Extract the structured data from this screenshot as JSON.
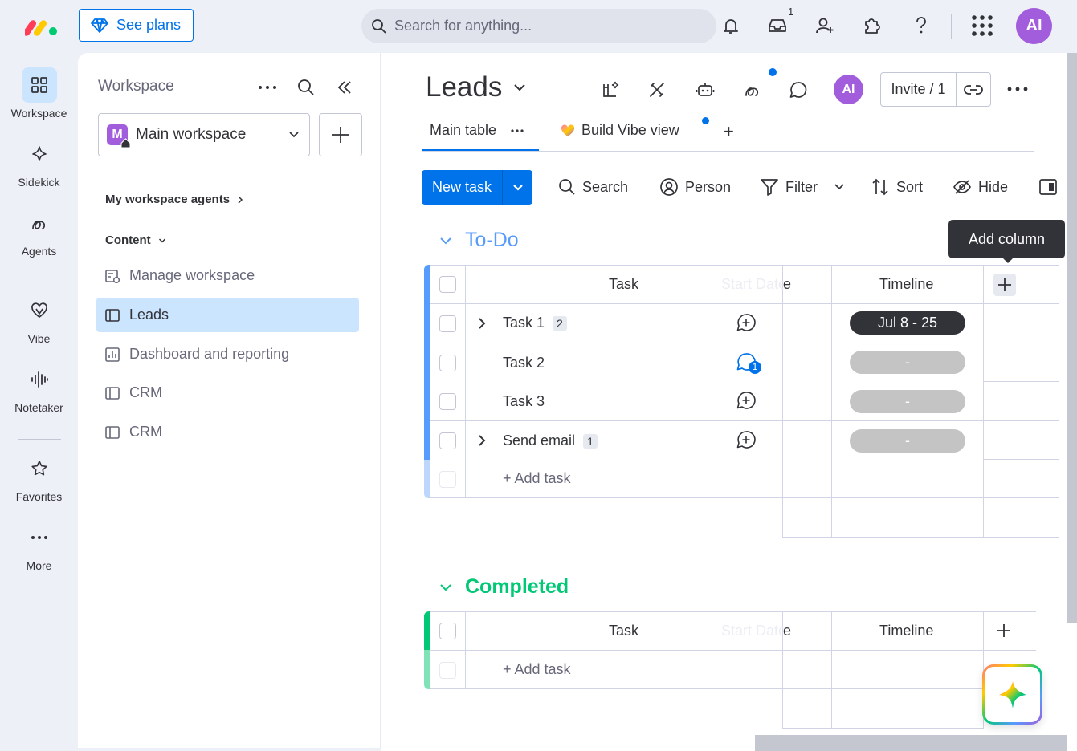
{
  "topbar": {
    "see_plans": "See plans",
    "search_placeholder": "Search for anything...",
    "inbox_count": "1",
    "user_initials": "AI"
  },
  "rail": {
    "items": [
      {
        "label": "Workspace",
        "icon": "workspace-grid-icon"
      },
      {
        "label": "Sidekick",
        "icon": "sparkle-icon"
      },
      {
        "label": "Agents",
        "icon": "agents-icon"
      },
      {
        "label": "Vibe",
        "icon": "vibe-heart-icon"
      },
      {
        "label": "Notetaker",
        "icon": "waveform-icon"
      },
      {
        "label": "Favorites",
        "icon": "star-icon"
      },
      {
        "label": "More",
        "icon": "more-dots-icon"
      }
    ]
  },
  "sidebar": {
    "title": "Workspace",
    "workspace_name": "Main workspace",
    "workspace_initial": "M",
    "agents_label": "My workspace agents",
    "content_label": "Content",
    "items": [
      {
        "label": "Manage workspace"
      },
      {
        "label": "Leads"
      },
      {
        "label": "Dashboard and reporting"
      },
      {
        "label": "CRM"
      },
      {
        "label": "CRM"
      }
    ]
  },
  "board": {
    "title": "Leads",
    "invite": "Invite / 1",
    "user_initials": "AI",
    "tabs": {
      "main": "Main table",
      "vibe": "Build Vibe view",
      "add": "+"
    },
    "toolbar": {
      "new_task": "New task",
      "search": "Search",
      "person": "Person",
      "filter": "Filter",
      "sort": "Sort",
      "hide": "Hide"
    },
    "tooltip": "Add column",
    "columns": {
      "task": "Task",
      "start_date_faded": "Start Date",
      "start_date_visible": "e",
      "timeline": "Timeline"
    },
    "groups": [
      {
        "title": "To-Do",
        "color": "#579bfc",
        "rows": [
          {
            "name": "Task 1",
            "subitems": "2",
            "timeline": "Jul 8 - 25",
            "updates": ""
          },
          {
            "name": "Task 2",
            "subitems": "",
            "timeline": "-",
            "updates": "1"
          },
          {
            "name": "Task 3",
            "subitems": "",
            "timeline": "-",
            "updates": ""
          },
          {
            "name": "Send email",
            "subitems": "1",
            "timeline": "-",
            "updates": ""
          }
        ],
        "add_task": "+ Add task"
      },
      {
        "title": "Completed",
        "color": "#00c875",
        "rows": [],
        "add_task": "+ Add task"
      }
    ]
  }
}
